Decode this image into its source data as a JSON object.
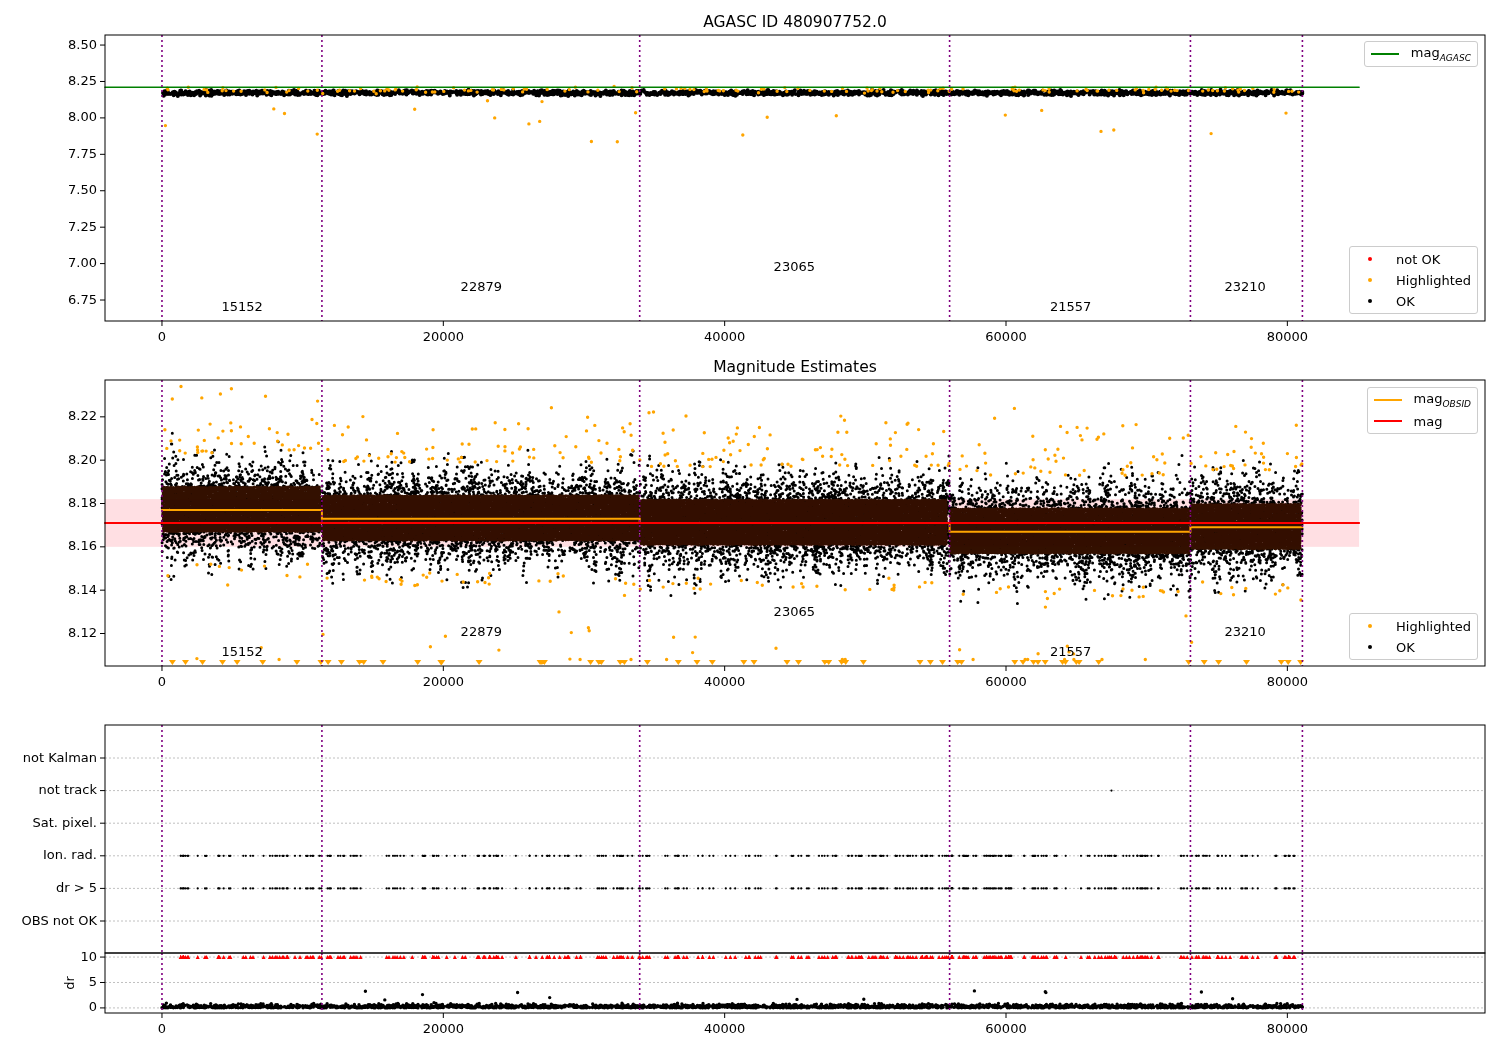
{
  "figure": {
    "panels": [
      {
        "chart_data": {
          "type": "line",
          "title": "AGASC ID 480907752.0",
          "xlim": [
            -4050,
            94050
          ],
          "ylim": [
            6.606,
            8.569
          ],
          "xticks": [
            0,
            20000,
            40000,
            60000,
            80000
          ],
          "yticks": [
            {
              "value": 6.75,
              "label": "6.75"
            },
            {
              "value": 7.0,
              "label": "7.00"
            },
            {
              "value": 7.25,
              "label": "7.25"
            },
            {
              "value": 7.5,
              "label": "7.50"
            },
            {
              "value": 7.75,
              "label": "7.75"
            },
            {
              "value": 8.0,
              "label": "8.00"
            },
            {
              "value": 8.25,
              "label": "8.25"
            },
            {
              "value": 8.5,
              "label": "8.50"
            }
          ],
          "series": [
            {
              "name": "mag$_{AGASC}$",
              "color": "#008000",
              "x": [
                -4050,
                85100
              ],
              "values": [
                8.21,
                8.21
              ]
            }
          ],
          "ref_lines": [
            {
              "axis": "x",
              "value": 0,
              "color": "#800080"
            },
            {
              "axis": "x",
              "value": 11370,
              "color": "#800080"
            },
            {
              "axis": "x",
              "value": 33960,
              "color": "#800080"
            },
            {
              "axis": "x",
              "value": 55990,
              "color": "#800080"
            },
            {
              "axis": "x",
              "value": 73110,
              "color": "#800080"
            },
            {
              "axis": "x",
              "value": 81070,
              "color": "#800080"
            }
          ],
          "annotations": [
            "15152",
            "22879",
            "23065",
            "21557",
            "23210"
          ]
        },
        "points": [
          {
            "label": "not OK",
            "color": "#ff0000"
          },
          {
            "label": "Highlighted",
            "color": "#ffa500"
          },
          {
            "label": "OK",
            "color": "#000000"
          }
        ]
      },
      {
        "chart_data": {
          "type": "line",
          "title": "Magnitude Estimates",
          "xlim": [
            -4050,
            94050
          ],
          "ylim": [
            8.105,
            8.237
          ],
          "xticks": [
            0,
            20000,
            40000,
            60000,
            80000
          ],
          "yticks": [
            {
              "value": 8.12,
              "label": "8.12"
            },
            {
              "value": 8.14,
              "label": "8.14"
            },
            {
              "value": 8.16,
              "label": "8.16"
            },
            {
              "value": 8.18,
              "label": "8.18"
            },
            {
              "value": 8.2,
              "label": "8.20"
            },
            {
              "value": 8.22,
              "label": "8.22"
            }
          ],
          "series": [
            {
              "name": "mag$_{OBSID}$",
              "color": "#ffa500",
              "x": [
                0,
                11370,
                11370,
                33960,
                33960,
                55990,
                55990,
                73110,
                73110,
                81070
              ],
              "values": [
                8.177,
                8.177,
                8.173,
                8.173,
                8.171,
                8.171,
                8.167,
                8.167,
                8.169,
                8.169
              ]
            },
            {
              "name": "mag",
              "color": "#ff0000",
              "x": [
                -4050,
                85100
              ],
              "values": [
                8.171,
                8.171
              ]
            }
          ],
          "bands": [
            {
              "axis": "y",
              "from": 8.16,
              "to": 8.182,
              "color": "#ffdfe3"
            }
          ],
          "ref_lines": [
            {
              "axis": "x",
              "value": 0,
              "color": "#800080"
            },
            {
              "axis": "x",
              "value": 11370,
              "color": "#800080"
            },
            {
              "axis": "x",
              "value": 33960,
              "color": "#800080"
            },
            {
              "axis": "x",
              "value": 55990,
              "color": "#800080"
            },
            {
              "axis": "x",
              "value": 73110,
              "color": "#800080"
            },
            {
              "axis": "x",
              "value": 81070,
              "color": "#800080"
            }
          ],
          "annotations": [
            "15152",
            "22879",
            "23065",
            "21557",
            "23210"
          ]
        },
        "points": [
          {
            "label": "Highlighted",
            "color": "#ffa500"
          },
          {
            "label": "OK",
            "color": "#000000"
          }
        ]
      },
      {
        "flags": [
          "not Kalman",
          "not track",
          "Sat. pixel.",
          "Ion. rad.",
          "dr > 5",
          "OBS not OK"
        ]
      },
      {
        "chart_data": {
          "type": "scatter",
          "ylabel": "dr",
          "xlim": [
            -4050,
            94050
          ],
          "ylim": [
            -1,
            10.8
          ],
          "xticks": [
            0,
            20000,
            40000,
            60000,
            80000
          ],
          "yticks": [
            0,
            5,
            10
          ],
          "ref_lines": [
            {
              "axis": "x",
              "value": 0,
              "color": "#800080"
            },
            {
              "axis": "x",
              "value": 11370,
              "color": "#800080"
            },
            {
              "axis": "x",
              "value": 33960,
              "color": "#800080"
            },
            {
              "axis": "x",
              "value": 55990,
              "color": "#800080"
            },
            {
              "axis": "x",
              "value": 73110,
              "color": "#800080"
            },
            {
              "axis": "x",
              "value": 81070,
              "color": "#800080"
            }
          ]
        }
      }
    ]
  }
}
